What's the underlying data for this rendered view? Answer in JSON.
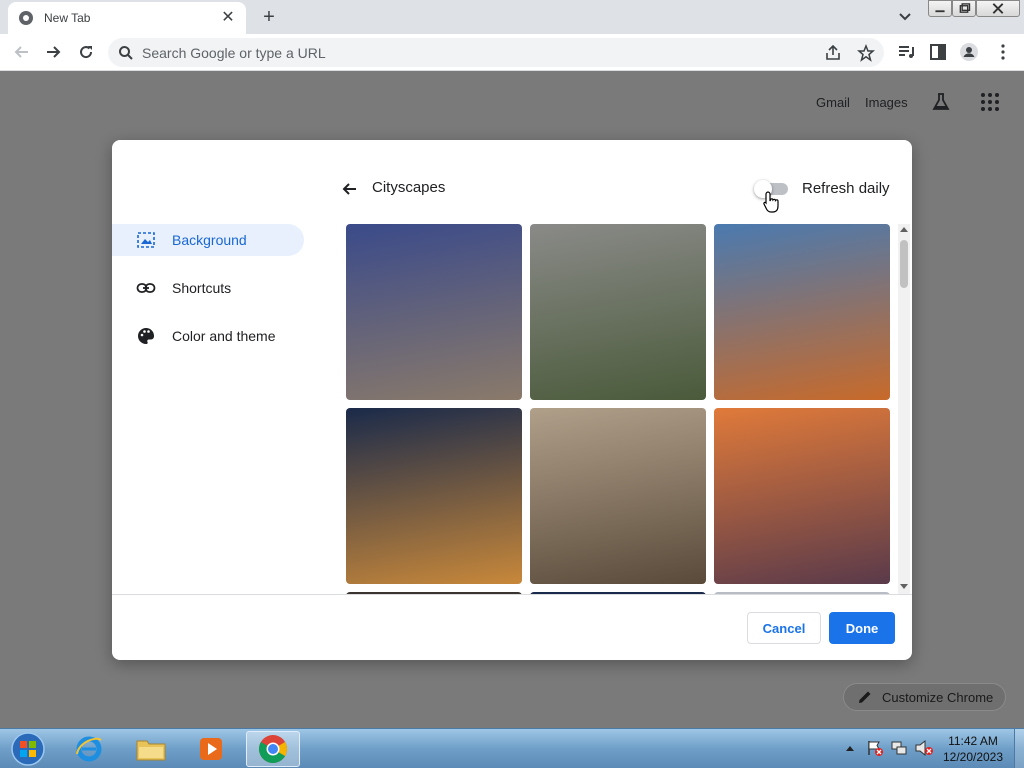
{
  "browser": {
    "tab_title": "New Tab",
    "omnibox_placeholder": "Search Google or type a URL"
  },
  "ntp": {
    "links": [
      "Gmail",
      "Images"
    ],
    "customize_label": "Customize Chrome"
  },
  "dialog": {
    "nav": [
      {
        "label": "Background",
        "icon": "image-icon",
        "selected": true
      },
      {
        "label": "Shortcuts",
        "icon": "link-icon",
        "selected": false
      },
      {
        "label": "Color and theme",
        "icon": "palette-icon",
        "selected": false
      }
    ],
    "collection_title": "Cityscapes",
    "refresh_label": "Refresh daily",
    "refresh_on": false,
    "tiles": [
      {
        "name": "tile-half-timbered-house",
        "c1": "#3a4a8a",
        "c2": "#8a7a6a"
      },
      {
        "name": "tile-hilltop-castle",
        "c1": "#8a8a88",
        "c2": "#4a5a3a"
      },
      {
        "name": "tile-neuschwanstein",
        "c1": "#4a7ab0",
        "c2": "#c86a2a"
      },
      {
        "name": "tile-salzburg-night",
        "c1": "#1a2a4a",
        "c2": "#c8883a"
      },
      {
        "name": "tile-cobbled-street",
        "c1": "#b0a08a",
        "c2": "#5a4a3a"
      },
      {
        "name": "tile-golden-gate",
        "c1": "#e07a3a",
        "c2": "#5a3a4a"
      }
    ],
    "cancel_label": "Cancel",
    "done_label": "Done"
  },
  "taskbar": {
    "time": "11:42 AM",
    "date": "12/20/2023"
  },
  "colors": {
    "accent": "#1a73e8",
    "selected_bg": "#e8f0fe",
    "overlay": "#7a7a7a"
  }
}
